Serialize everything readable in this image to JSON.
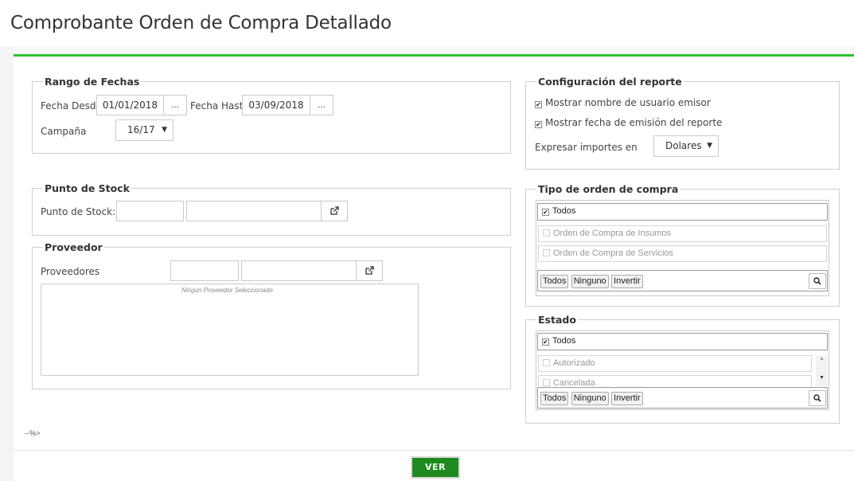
{
  "page": {
    "title": "Comprobante Orden de Compra Detallado",
    "footer_text": "--%>"
  },
  "colors": {
    "accent": "#2ec02e",
    "button_bg": "#1f8a1f"
  },
  "rango_fechas": {
    "legend": "Rango de Fechas",
    "desde_label": "Fecha Desde",
    "desde_value": "01/01/2018",
    "hasta_label": "Fecha Hasta",
    "hasta_value": "03/09/2018",
    "dots": "...",
    "campana_label": "Campaña",
    "campana_value": "16/17"
  },
  "punto_stock": {
    "legend": "Punto de Stock",
    "label": "Punto de Stock:",
    "icon": "external-link-icon"
  },
  "proveedor": {
    "legend": "Proveedor",
    "label": "Proveedores",
    "empty_text": "Ningún Proveedor Seleccionado",
    "icon": "external-link-icon"
  },
  "config": {
    "legend": "Configuración del reporte",
    "opt_usuario": "Mostrar nombre de usuario emisor",
    "opt_usuario_checked": true,
    "opt_fecha": "Mostrar fecha de emisión del reporte",
    "opt_fecha_checked": true,
    "importes_label": "Expresar importes en",
    "importes_value": "Dolares"
  },
  "tipo_orden": {
    "legend": "Tipo de orden de compra",
    "all_label": "Todos",
    "all_checked": true,
    "items": [
      {
        "label": "Orden de Compra de Insumos",
        "checked": false
      },
      {
        "label": "Orden de Compra de Servicios",
        "checked": false
      }
    ],
    "btn_todos": "Todos",
    "btn_ninguno": "Ninguno",
    "btn_invertir": "Invertir"
  },
  "estado": {
    "legend": "Estado",
    "all_label": "Todos",
    "all_checked": true,
    "items": [
      {
        "label": "Autorizado",
        "checked": false
      },
      {
        "label": "Cancelada",
        "checked": false
      }
    ],
    "btn_todos": "Todos",
    "btn_ninguno": "Ninguno",
    "btn_invertir": "Invertir"
  },
  "actions": {
    "ver_label": "VER"
  }
}
